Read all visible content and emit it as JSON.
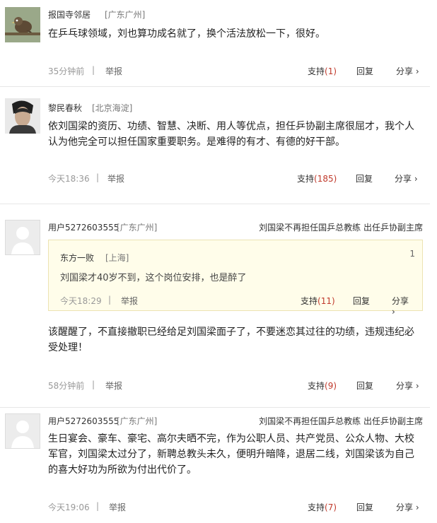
{
  "comments": [
    {
      "username": "报国寺邻居",
      "location": "[广东广州]",
      "text": "在乒乓球领域，刘也算功成名就了，换个活法放松一下，很好。",
      "time": "35分钟前",
      "report": "举报",
      "support_label": "支持",
      "support_count": "(1)",
      "reply": "回复",
      "share": "分享 ›"
    },
    {
      "username": "黎民春秋",
      "location": "[北京海淀]",
      "text_line1": "依刘国梁的资历、功绩、智慧、决断、用人等优点，担任乒协副主席很屈才，我个人",
      "text_line2": "认为他完全可以担任国家重要职务。是难得的有才、有德的好干部。",
      "time": "今天18:36",
      "report": "举报",
      "support_label": "支持",
      "support_count": "(185)",
      "reply": "回复",
      "share": "分享 ›"
    },
    {
      "username": "用户5272603555",
      "location": "[广东广州]",
      "article_ref": "刘国梁不再担任国乒总教练 出任乒协副主席",
      "quote": {
        "username": "东方一败",
        "location": "[上海]",
        "floor": "1",
        "text": "刘国梁才40岁不到，这个岗位安排，也是醉了",
        "time": "今天18:29",
        "report": "举报",
        "support_label": "支持",
        "support_count": "(11)",
        "reply": "回复",
        "share": "分享 ›"
      },
      "text_line1": "该醒醒了，不直接撤职已经给足刘国梁面子了，不要迷恋其过往的功绩，违规违纪必",
      "text_line2": "受处理！",
      "time": "58分钟前",
      "report": "举报",
      "support_label": "支持",
      "support_count": "(9)",
      "reply": "回复",
      "share": "分享 ›"
    },
    {
      "username": "用户5272603555",
      "location": "[广东广州]",
      "article_ref": "刘国梁不再担任国乒总教练 出任乒协副主席",
      "text_line1": "生日宴会、豪车、豪宅、高尔夫晒不完，作为公职人员、共产党员、公众人物、大校",
      "text_line2": "军官，刘国梁太过分了，新聘总教头未久，便明升暗降，退居二线，刘国梁该为自己",
      "text_line3": "的喜大好功为所欲为付出代价了。",
      "time": "今天19:06",
      "report": "举报",
      "support_label": "支持",
      "support_count": "(7)",
      "reply": "回复",
      "share": "分享 ›"
    }
  ]
}
